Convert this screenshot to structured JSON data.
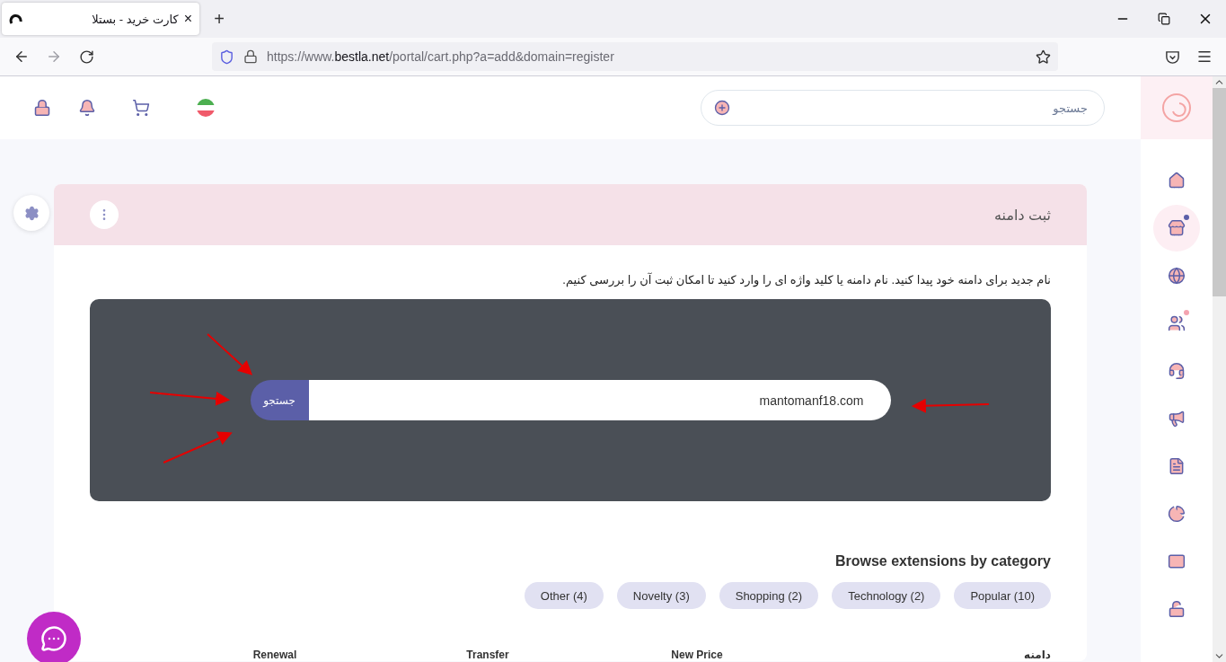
{
  "browser": {
    "tab": {
      "title": "کارت خرید - بستلا",
      "close": "×",
      "selected": true
    },
    "new_tab": "+",
    "url": {
      "prefix": "https://www.",
      "host": "bestla.net",
      "path": "/portal/cart.php?a=add&domain=register"
    }
  },
  "header": {
    "search": {
      "placeholder": "جستجو"
    }
  },
  "sidebar": {
    "items": [
      {
        "selected": false
      },
      {
        "selected": true,
        "color": "#5b5fa8"
      },
      {
        "selected": false
      },
      {
        "selected": false,
        "color": "#f4a4b0"
      },
      {
        "selected": false
      },
      {
        "selected": false
      },
      {
        "selected": false
      },
      {
        "selected": false
      },
      {
        "selected": false
      },
      {
        "selected": false
      }
    ]
  },
  "card": {
    "title": "ثبت دامنه",
    "description": "نام جدید برای دامنه خود پیدا کنید. نام دامنه یا کلید واژه ای را وارد کنید تا امکان ثبت آن را بررسی کنیم.",
    "domain_search": {
      "value": "mantomanf18.com",
      "button": "جستجو"
    },
    "categories_title": "Browse extensions by category",
    "categories": [
      "Popular (10)",
      "Technology (2)",
      "Shopping (2)",
      "Novelty (3)",
      "Other (4)"
    ],
    "table": {
      "columns": [
        "دامنه",
        "New Price",
        "Transfer",
        "Renewal"
      ]
    }
  }
}
